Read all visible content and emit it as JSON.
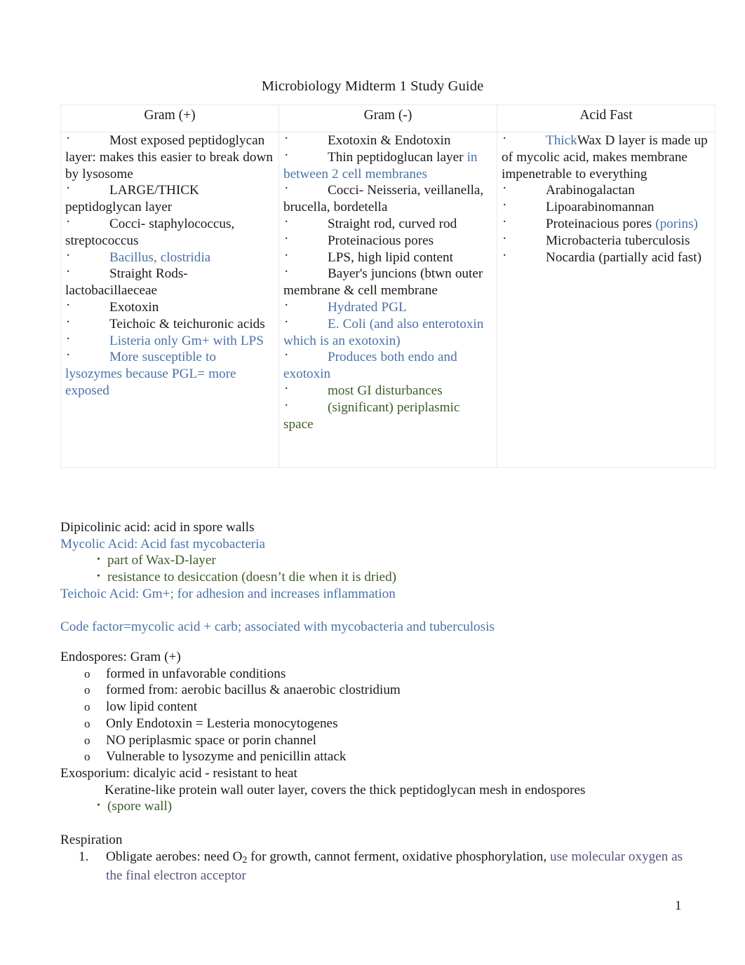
{
  "document": {
    "title": "Microbiology Midterm 1 Study Guide",
    "page_number": "1"
  },
  "colors": {
    "blue": "#4a72a8",
    "green": "#3b5c28",
    "purple": "#55557d",
    "text": "#1a1a1a",
    "table_border": "#ededed"
  },
  "table": {
    "columns": [
      {
        "header": "Gram (+)",
        "items": [
          {
            "parts": [
              {
                "text": "Most exposed peptidoglycan layer: makes this easier to break down by lysosome",
                "color": "black"
              }
            ]
          },
          {
            "parts": [
              {
                "text": "LARGE/THICK peptidoglycan layer",
                "color": "black"
              }
            ]
          },
          {
            "parts": [
              {
                "text": "Cocci- staphylococcus, streptococcus",
                "color": "black"
              }
            ]
          },
          {
            "parts": [
              {
                "text": "Bacillus, clostridia",
                "color": "blue"
              }
            ]
          },
          {
            "parts": [
              {
                "text": "Straight Rods- lactobacillaeceae",
                "color": "black"
              }
            ]
          },
          {
            "parts": [
              {
                "text": "Exotoxin",
                "color": "black"
              }
            ]
          },
          {
            "parts": [
              {
                "text": "Teichoic & teichuronic acids",
                "color": "black"
              }
            ]
          },
          {
            "parts": [
              {
                "text": "Listeria only Gm+ with LPS",
                "color": "blue"
              }
            ]
          },
          {
            "parts": [
              {
                "text": "More susceptible to lysozymes because PGL= more exposed",
                "color": "blue"
              }
            ]
          }
        ]
      },
      {
        "header": "Gram (-)",
        "items": [
          {
            "parts": [
              {
                "text": "Exotoxin & Endotoxin",
                "color": "black"
              }
            ]
          },
          {
            "parts": [
              {
                "text": "Thin peptidoglucan layer ",
                "color": "black"
              },
              {
                "text": "in between 2 cell membranes",
                "color": "blue"
              }
            ]
          },
          {
            "parts": [
              {
                "text": "Cocci- Neisseria, veillanella, brucella, bordetella",
                "color": "black"
              }
            ]
          },
          {
            "parts": [
              {
                "text": "Straight rod, curved rod",
                "color": "black"
              }
            ]
          },
          {
            "parts": [
              {
                "text": "Proteinacious pores",
                "color": "black"
              }
            ]
          },
          {
            "parts": [
              {
                "text": "LPS, high lipid content",
                "color": "black"
              }
            ]
          },
          {
            "parts": [
              {
                "text": "Bayer's juncions (btwn outer membrane & cell membrane",
                "color": "black"
              }
            ]
          },
          {
            "parts": [
              {
                "text": "Hydrated PGL",
                "color": "blue"
              }
            ]
          },
          {
            "parts": [
              {
                "text": "E. Coli (and also enterotoxin which is an exotoxin)",
                "color": "blue"
              }
            ]
          },
          {
            "parts": [
              {
                "text": "Produces both endo and exotoxin",
                "color": "blue"
              }
            ]
          },
          {
            "parts": [
              {
                "text": "most GI disturbances",
                "color": "green"
              }
            ]
          },
          {
            "parts": [
              {
                "text": "(significant) periplasmic space",
                "color": "green"
              }
            ]
          }
        ]
      },
      {
        "header": "Acid Fast",
        "items": [
          {
            "parts": [
              {
                "text": "Thick",
                "color": "blue"
              },
              {
                "text": "Wax D layer is made up of mycolic acid, makes membrane impenetrable to everything",
                "color": "black"
              }
            ]
          },
          {
            "parts": [
              {
                "text": "Arabinogalactan",
                "color": "black"
              }
            ]
          },
          {
            "parts": [
              {
                "text": "Lipoarabinomannan",
                "color": "black"
              }
            ]
          },
          {
            "parts": [
              {
                "text": "Proteinacious pores ",
                "color": "black"
              },
              {
                "text": "(porins)",
                "color": "blue"
              }
            ]
          },
          {
            "parts": [
              {
                "text": "Microbacteria tuberculosis",
                "color": "black"
              }
            ]
          },
          {
            "parts": [
              {
                "text": "Nocardia (partially acid fast)",
                "color": "black"
              }
            ]
          }
        ]
      }
    ]
  },
  "acids_section": {
    "dipicolinic": "Dipicolinic acid: acid in spore walls",
    "mycolic": "Mycolic Acid: Acid fast mycobacteria",
    "mycolic_bullets": [
      "part of Wax-D-layer",
      "resistance to desiccation (doesn’t die when it is dried)"
    ],
    "teichoic": "Teichoic Acid: Gm+; for adhesion and increases inflammation",
    "code_factor": "Code factor=mycolic acid + carb; associated with mycobacteria and tuberculosis"
  },
  "endospores_section": {
    "heading": "Endospores: Gram (+)",
    "items": [
      "formed in unfavorable conditions",
      "formed from: aerobic bacillus & anaerobic clostridium",
      "low lipid content",
      "Only Endotoxin = Lesteria monocytogenes",
      "NO periplasmic space or porin channel",
      "Vulnerable to lysozyme and penicillin attack"
    ],
    "exosporium": "Exosporium: dicalyic acid - resistant to heat",
    "exosporium_detail": "Keratine-like protein wall outer layer, covers the thick peptidoglycan mesh in endospores",
    "exosporium_bullet": "(spore wall)"
  },
  "respiration_section": {
    "heading": "Respiration",
    "items": [
      {
        "number": "1.",
        "black_before": "Obligate aerobes: need O",
        "subscript": "2",
        "black_after": " for growth, cannot ferment, oxidative phosphorylation, ",
        "purple": "use molecular oxygen as the final electron acceptor"
      }
    ]
  }
}
